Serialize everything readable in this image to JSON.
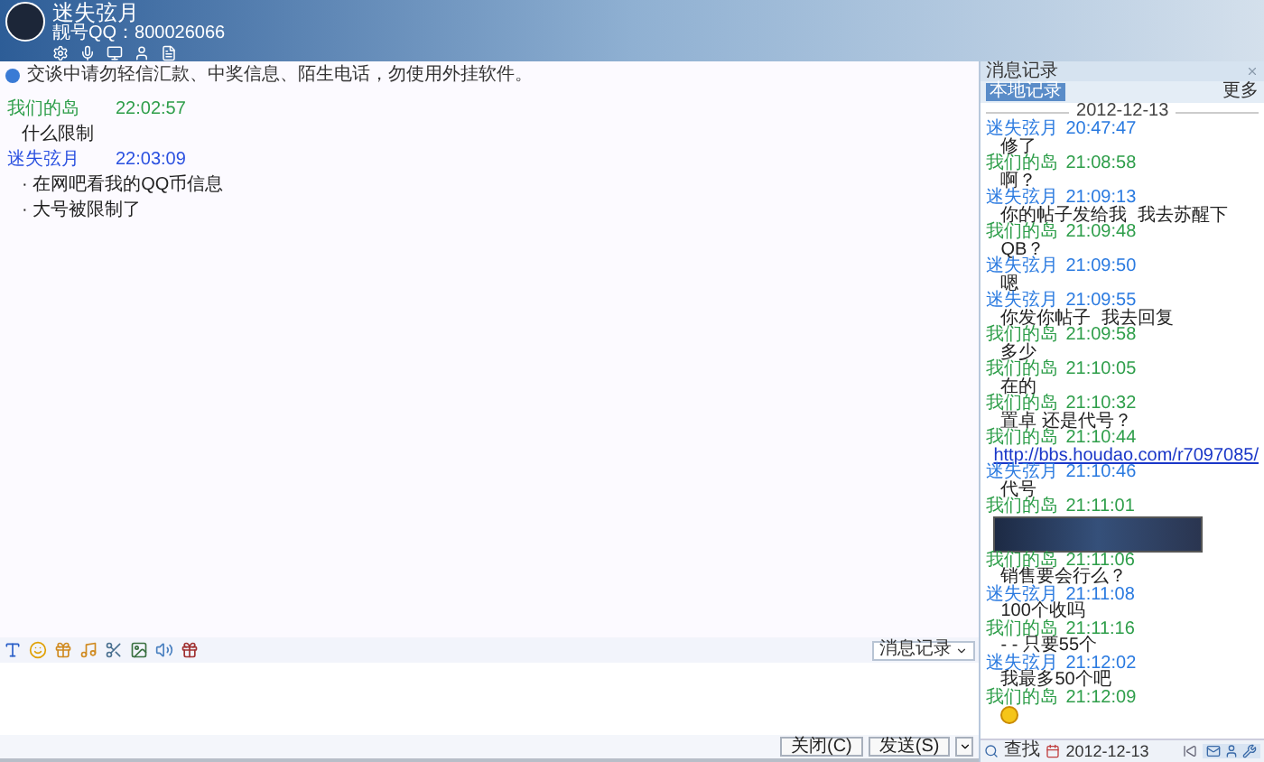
{
  "header": {
    "name": "迷失弦月",
    "account": "靓号QQ：800026066"
  },
  "notice": "交谈中请勿轻信汇款、中奖信息、陌生电话，勿使用外挂软件。",
  "chat": [
    {
      "sender": "我们的岛",
      "time": "22:02:57",
      "color": "#2e9e4a",
      "lines": [
        "什么限制"
      ]
    },
    {
      "sender": "迷失弦月",
      "time": "22:03:09",
      "color": "#2a50e0",
      "lines": [
        "· 在网吧看我的QQ币信息",
        "· 大号被限制了"
      ]
    }
  ],
  "input_toolbar": {
    "history_button": "消息记录"
  },
  "buttons": [
    {
      "label": "关闭(C)"
    },
    {
      "label": "发送(S)"
    }
  ],
  "history": {
    "title": "消息记录",
    "tab": {
      "label": "本地记录",
      "selected": true
    },
    "more": "更多",
    "date": "2012-12-13",
    "messages": [
      {
        "sender": "迷失弦月",
        "time": "20:47:47",
        "color": "#2a7ae0",
        "kind": "text",
        "text": "修了"
      },
      {
        "sender": "我们的岛",
        "time": "21:08:58",
        "color": "#2e9e4a",
        "kind": "text",
        "text": "啊？"
      },
      {
        "sender": "迷失弦月",
        "time": "21:09:13",
        "color": "#2a7ae0",
        "kind": "text",
        "text": "你的帖子发给我  我去苏醒下"
      },
      {
        "sender": "我们的岛",
        "time": "21:09:48",
        "color": "#2e9e4a",
        "kind": "text",
        "text": "QB？"
      },
      {
        "sender": "迷失弦月",
        "time": "21:09:50",
        "color": "#2a7ae0",
        "kind": "text",
        "text": "嗯"
      },
      {
        "sender": "迷失弦月",
        "time": "21:09:55",
        "color": "#2a7ae0",
        "kind": "text",
        "text": "你发你帖子  我去回复"
      },
      {
        "sender": "我们的岛",
        "time": "21:09:58",
        "color": "#2e9e4a",
        "kind": "text",
        "text": "多少"
      },
      {
        "sender": "我们的岛",
        "time": "21:10:05",
        "color": "#2e9e4a",
        "kind": "text",
        "text": "在的"
      },
      {
        "sender": "我们的岛",
        "time": "21:10:32",
        "color": "#2e9e4a",
        "kind": "text",
        "text": "置卓 还是代号？"
      },
      {
        "sender": "我们的岛",
        "time": "21:10:44",
        "color": "#2e9e4a",
        "kind": "link",
        "text": "http://bbs.houdao.com/r7097085/"
      },
      {
        "sender": "迷失弦月",
        "time": "21:10:46",
        "color": "#2a7ae0",
        "kind": "text",
        "text": "代号"
      },
      {
        "sender": "我们的岛",
        "time": "21:11:01",
        "color": "#2e9e4a",
        "kind": "image"
      },
      {
        "sender": "我们的岛",
        "time": "21:11:06",
        "color": "#2e9e4a",
        "kind": "text",
        "text": "销售要会行么？"
      },
      {
        "sender": "迷失弦月",
        "time": "21:11:08",
        "color": "#2a7ae0",
        "kind": "text",
        "text": "100个收吗"
      },
      {
        "sender": "我们的岛",
        "time": "21:11:16",
        "color": "#2e9e4a",
        "kind": "text",
        "text": "- - 只要55个"
      },
      {
        "sender": "迷失弦月",
        "time": "21:12:02",
        "color": "#2a7ae0",
        "kind": "text",
        "text": "我最多50个吧"
      },
      {
        "sender": "我们的岛",
        "time": "21:12:09",
        "color": "#2e9e4a",
        "kind": "emoji"
      }
    ],
    "search": "查找",
    "footer_date": "2012-12-13"
  }
}
